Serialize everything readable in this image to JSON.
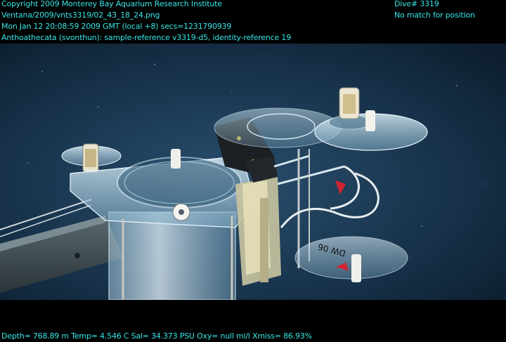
{
  "overlay": {
    "top_left": [
      "Copyright 2009 Monterey Bay Aquarium Research Institute",
      "Ventana/2009/vnts3319/02_43_18_24.png",
      "Mon Jan 12 20:08:59 2009 GMT (local +8)  secs=1231790939",
      "Anthoathecata (svonthun): sample-reference v3319-d5, identity-reference 19"
    ],
    "top_right": [
      "Dive# 3319",
      "No match for position"
    ],
    "bottom": "Depth= 768.89 m  Temp= 4.546 C  Sal= 34.373 PSU  Oxy= null ml/l  Xmiss= 86.93%"
  },
  "scene": {
    "water_color": "#17324a",
    "overlay_text_color": "#38e6e6",
    "equipment_label": "DW 06"
  }
}
